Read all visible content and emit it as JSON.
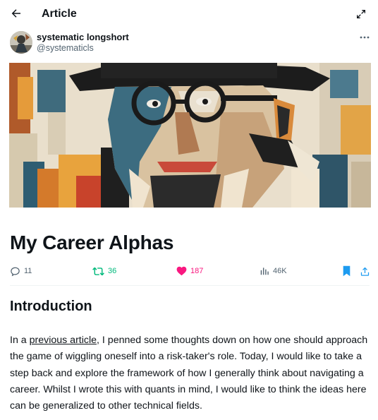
{
  "header": {
    "title": "Article",
    "back_icon": "arrow-left-icon",
    "expand_icon": "expand-icon"
  },
  "author": {
    "name": "systematic longshort",
    "handle": "@systematicls",
    "more_icon": "more-dots-icon"
  },
  "article": {
    "title": "My Career Alphas",
    "cover_icon": "cubist-portrait-image"
  },
  "actions": {
    "replies": "11",
    "reposts": "36",
    "likes": "187",
    "views": "46K",
    "colors": {
      "repost": "#00ba7c",
      "like": "#f91880",
      "bookmark": "#1d9bf0",
      "muted": "#536471"
    }
  },
  "content": {
    "heading": "Introduction",
    "p1_before": "In a ",
    "p1_link": "previous article",
    "p1_after": ", I penned some thoughts down on how one should approach the game of wiggling oneself into a risk-taker's role. Today, I would like to take a step back and explore the framework of how I generally think about navigating a career. Whilst I wrote this with quants in mind, I would like to think the ideas here can be generalized to other technical fields."
  }
}
